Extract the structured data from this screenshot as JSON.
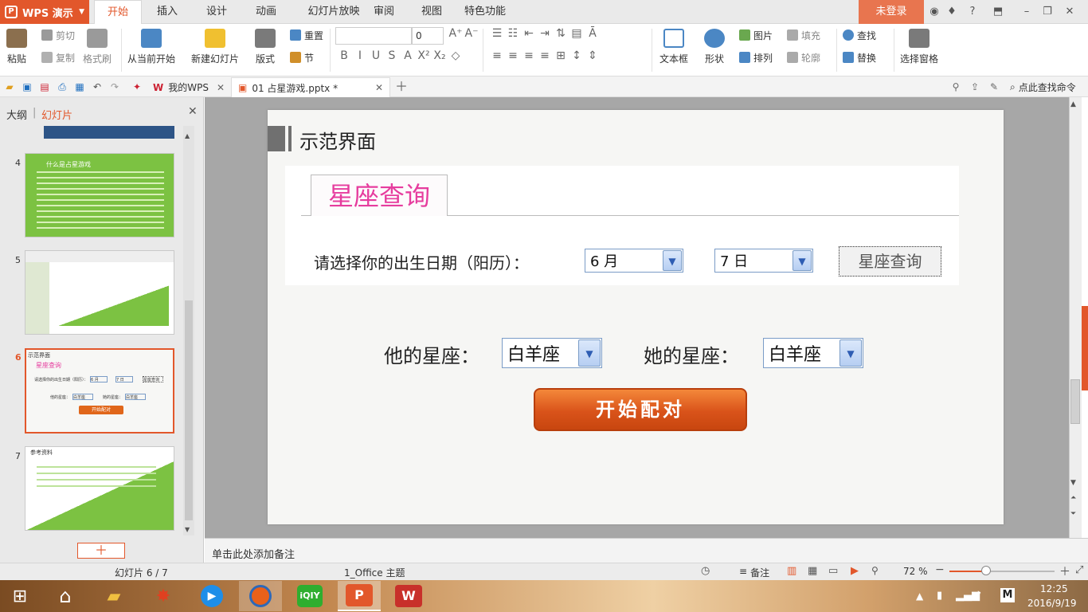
{
  "app": {
    "name": "WPS 演示",
    "login": "未登录"
  },
  "tabs": [
    "开始",
    "插入",
    "设计",
    "动画",
    "幻灯片放映",
    "审阅",
    "视图",
    "特色功能"
  ],
  "ribbon": {
    "paste": "粘贴",
    "cut": "剪切",
    "copy": "复制",
    "format_painter": "格式刷",
    "from_current": "从当前开始",
    "new_slide": "新建幻灯片",
    "layout": "版式",
    "reset": "重置",
    "section": "节",
    "font_size": "0",
    "textbox": "文本框",
    "shape": "形状",
    "picture": "图片",
    "fill": "填充",
    "arrange": "排列",
    "outline": "轮廓",
    "find": "查找",
    "replace": "替换",
    "select_pane": "选择窗格"
  },
  "quick": {
    "my_wps": "我的WPS",
    "doc_tab": "01 占星游戏.pptx *",
    "search": "点此查找命令"
  },
  "panel": {
    "outline": "大纲",
    "slides": "幻灯片"
  },
  "thumbs": [
    {
      "num": "4",
      "title": "什么是占星游戏"
    },
    {
      "num": "5"
    },
    {
      "num": "6",
      "title": "示范界面",
      "query": "星座查询",
      "date_label": "请选择你的出生日期（阳历）：",
      "month": "6 月",
      "day": "7 日",
      "btn": "星座查询",
      "his": "他的星座：",
      "her": "她的星座：",
      "sign": "白羊座",
      "start": "开始配对"
    },
    {
      "num": "7",
      "title": "参考资料"
    }
  ],
  "slide": {
    "title": "示范界面",
    "query_tab": "星座查询",
    "date_label": "请选择你的出生日期（阳历）：",
    "month": "6 月",
    "day": "7 日",
    "query_btn": "星座查询",
    "his_label": "他的星座：",
    "his_sign": "白羊座",
    "her_label": "她的星座：",
    "her_sign": "白羊座",
    "start_btn": "开始配对"
  },
  "notes": "单击此处添加备注",
  "status": {
    "slide": "幻灯片 6 / 7",
    "theme": "1_Office 主题",
    "notes_btn": "备注",
    "zoom": "72 %"
  },
  "taskbar": {
    "time": "12:25",
    "date": "2016/9/19",
    "ime": "M"
  },
  "colors": {
    "accent": "#e2572b",
    "pink": "#e63d9e",
    "green": "#7cc242",
    "start_btn": "#e0661a"
  }
}
